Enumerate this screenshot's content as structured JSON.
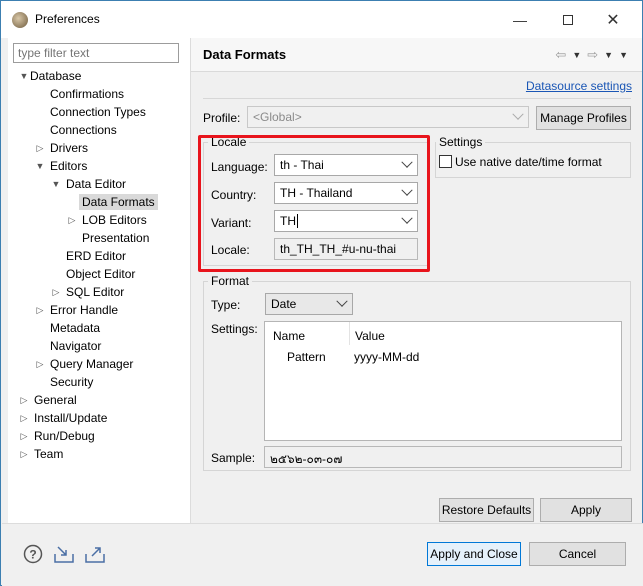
{
  "window": {
    "title": "Preferences"
  },
  "sidebar": {
    "filter_placeholder": "type filter text",
    "tree": [
      {
        "label": "Database",
        "expanded": true
      },
      {
        "label": "Confirmations"
      },
      {
        "label": "Connection Types"
      },
      {
        "label": "Connections"
      },
      {
        "label": "Drivers",
        "expanded": false
      },
      {
        "label": "Editors",
        "expanded": true
      },
      {
        "label": "Data Editor",
        "expanded": true
      },
      {
        "label": "Data Formats",
        "selected": true
      },
      {
        "label": "LOB Editors",
        "expanded": false
      },
      {
        "label": "Presentation"
      },
      {
        "label": "ERD Editor"
      },
      {
        "label": "Object Editor"
      },
      {
        "label": "SQL Editor",
        "expanded": false
      },
      {
        "label": "Error Handle",
        "expanded": false
      },
      {
        "label": "Metadata"
      },
      {
        "label": "Navigator"
      },
      {
        "label": "Query Manager",
        "expanded": false
      },
      {
        "label": "Security"
      },
      {
        "label": "General",
        "expanded": false
      },
      {
        "label": "Install/Update",
        "expanded": false
      },
      {
        "label": "Run/Debug",
        "expanded": false
      },
      {
        "label": "Team",
        "expanded": false
      }
    ]
  },
  "page": {
    "title": "Data Formats",
    "datasource_link": "Datasource settings",
    "profile_label": "Profile:",
    "profile_value": "<Global>",
    "manage_profiles": "Manage Profiles"
  },
  "locale": {
    "group_title": "Locale",
    "language_label": "Language:",
    "language_value": "th - Thai",
    "country_label": "Country:",
    "country_value": "TH - Thailand",
    "variant_label": "Variant:",
    "variant_value": "TH",
    "locale_label": "Locale:",
    "locale_value": "th_TH_TH_#u-nu-thai"
  },
  "settings": {
    "group_title": "Settings",
    "native_datetime": "Use native date/time format",
    "native_datetime_checked": false
  },
  "format": {
    "group_title": "Format",
    "type_label": "Type:",
    "type_value": "Date",
    "settings_label": "Settings:",
    "columns": [
      "Name",
      "Value"
    ],
    "rows": [
      {
        "name": "Pattern",
        "value": "yyyy-MM-dd"
      }
    ],
    "sample_label": "Sample:",
    "sample_value": "๒๕๖๒-๐๓-๐๗"
  },
  "buttons": {
    "restore_defaults": "Restore Defaults",
    "apply": "Apply",
    "apply_and_close": "Apply and Close",
    "cancel": "Cancel"
  },
  "colors": {
    "highlight": "#e8141c",
    "link": "#1a56b5",
    "accent": "#0078d7"
  }
}
